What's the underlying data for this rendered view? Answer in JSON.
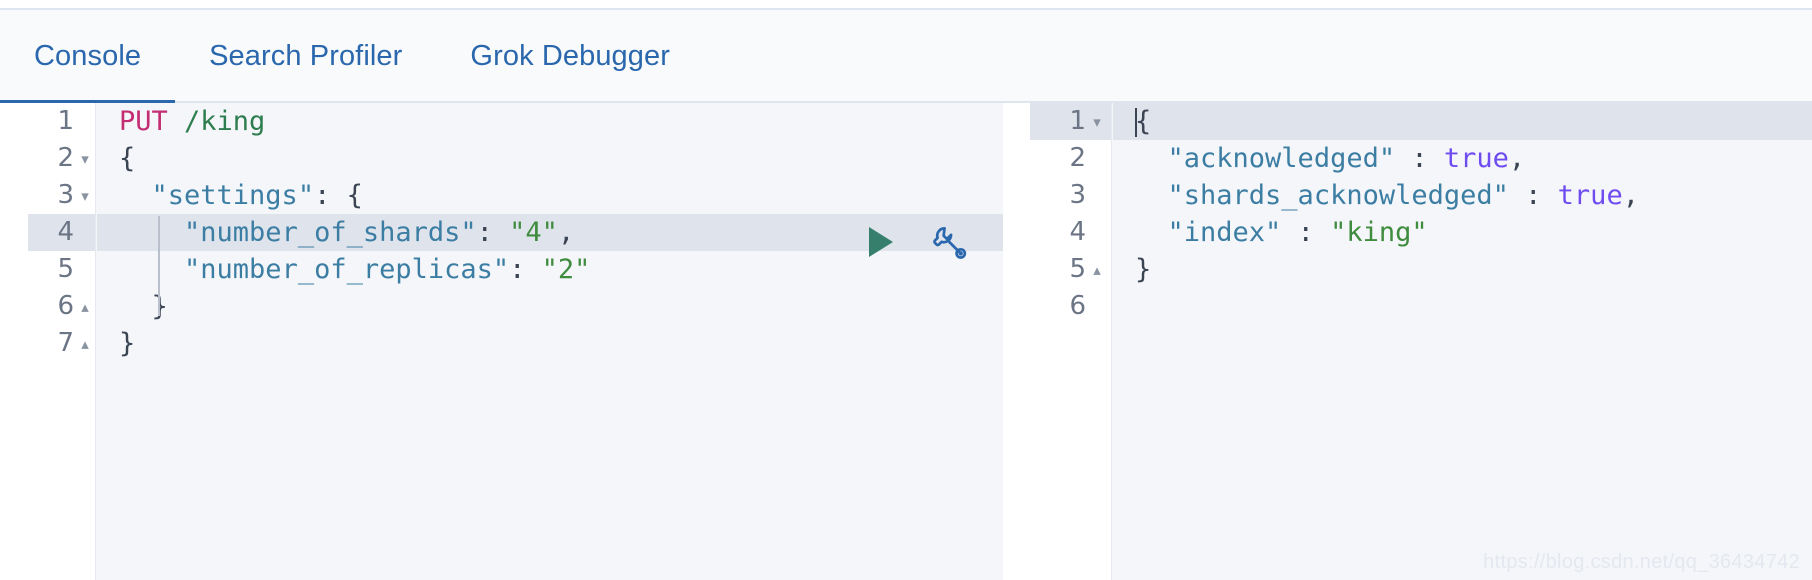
{
  "tabs": [
    {
      "label": "Console",
      "active": true
    },
    {
      "label": "Search Profiler",
      "active": false
    },
    {
      "label": "Grok Debugger",
      "active": false
    }
  ],
  "colors": {
    "accent": "#2a67ad",
    "method": "#c42d71",
    "url": "#2e7d4f",
    "key": "#3c7ea3",
    "string": "#3f8c3f",
    "boolean": "#6f4cf0",
    "play": "#357f6c",
    "highlight": "#dfe3ec",
    "pane_bg": "#f5f6fa",
    "block_bg": "#e9ecf2"
  },
  "toolbar": {
    "play_label": "play-icon",
    "play_title": "Click to send request",
    "wrench_label": "wrench-icon",
    "wrench_title": "Open documentation"
  },
  "request_editor": {
    "name": "request-editor",
    "lines": [
      {
        "number": "1",
        "fold": "",
        "tokens": [
          {
            "text": "PUT ",
            "type": "method"
          },
          {
            "text": "/king",
            "type": "url"
          }
        ]
      },
      {
        "number": "2",
        "fold": "▾",
        "tokens": [
          {
            "text": "{",
            "type": "punc"
          }
        ]
      },
      {
        "number": "3",
        "fold": "▾",
        "tokens": [
          {
            "text": "  ",
            "type": "punc"
          },
          {
            "text": "\"settings\"",
            "type": "key"
          },
          {
            "text": ": {",
            "type": "punc"
          }
        ]
      },
      {
        "number": "4",
        "fold": "",
        "highlight": true,
        "tokens": [
          {
            "text": "    ",
            "type": "punc"
          },
          {
            "text": "\"number_of_shards\"",
            "type": "key"
          },
          {
            "text": ": ",
            "type": "punc"
          },
          {
            "text": "\"4\"",
            "type": "string"
          },
          {
            "text": ",",
            "type": "punc"
          }
        ]
      },
      {
        "number": "5",
        "fold": "",
        "tokens": [
          {
            "text": "    ",
            "type": "punc"
          },
          {
            "text": "\"number_of_replicas\"",
            "type": "key"
          },
          {
            "text": ": ",
            "type": "punc"
          },
          {
            "text": "\"2\"",
            "type": "string"
          }
        ]
      },
      {
        "number": "6",
        "fold": "▴",
        "tokens": [
          {
            "text": "  }",
            "type": "punc"
          }
        ]
      },
      {
        "number": "7",
        "fold": "▴",
        "tokens": [
          {
            "text": "}",
            "type": "punc"
          }
        ]
      }
    ]
  },
  "response_editor": {
    "name": "response-editor",
    "lines": [
      {
        "number": "1",
        "fold": "▾",
        "highlight": true,
        "caret": true,
        "tokens": [
          {
            "text": "{",
            "type": "punc"
          }
        ]
      },
      {
        "number": "2",
        "fold": "",
        "tokens": [
          {
            "text": "  ",
            "type": "punc"
          },
          {
            "text": "\"acknowledged\"",
            "type": "key"
          },
          {
            "text": " : ",
            "type": "punc"
          },
          {
            "text": "true",
            "type": "boolean"
          },
          {
            "text": ",",
            "type": "punc"
          }
        ]
      },
      {
        "number": "3",
        "fold": "",
        "tokens": [
          {
            "text": "  ",
            "type": "punc"
          },
          {
            "text": "\"shards_acknowledged\"",
            "type": "key"
          },
          {
            "text": " : ",
            "type": "punc"
          },
          {
            "text": "true",
            "type": "boolean"
          },
          {
            "text": ",",
            "type": "punc"
          }
        ]
      },
      {
        "number": "4",
        "fold": "",
        "tokens": [
          {
            "text": "  ",
            "type": "punc"
          },
          {
            "text": "\"index\"",
            "type": "key"
          },
          {
            "text": " : ",
            "type": "punc"
          },
          {
            "text": "\"king\"",
            "type": "string"
          }
        ]
      },
      {
        "number": "5",
        "fold": "▴",
        "tokens": [
          {
            "text": "}",
            "type": "punc"
          }
        ]
      },
      {
        "number": "6",
        "fold": "",
        "tokens": []
      }
    ]
  },
  "watermark": {
    "text": "https://blog.csdn.net/qq_36434742"
  }
}
